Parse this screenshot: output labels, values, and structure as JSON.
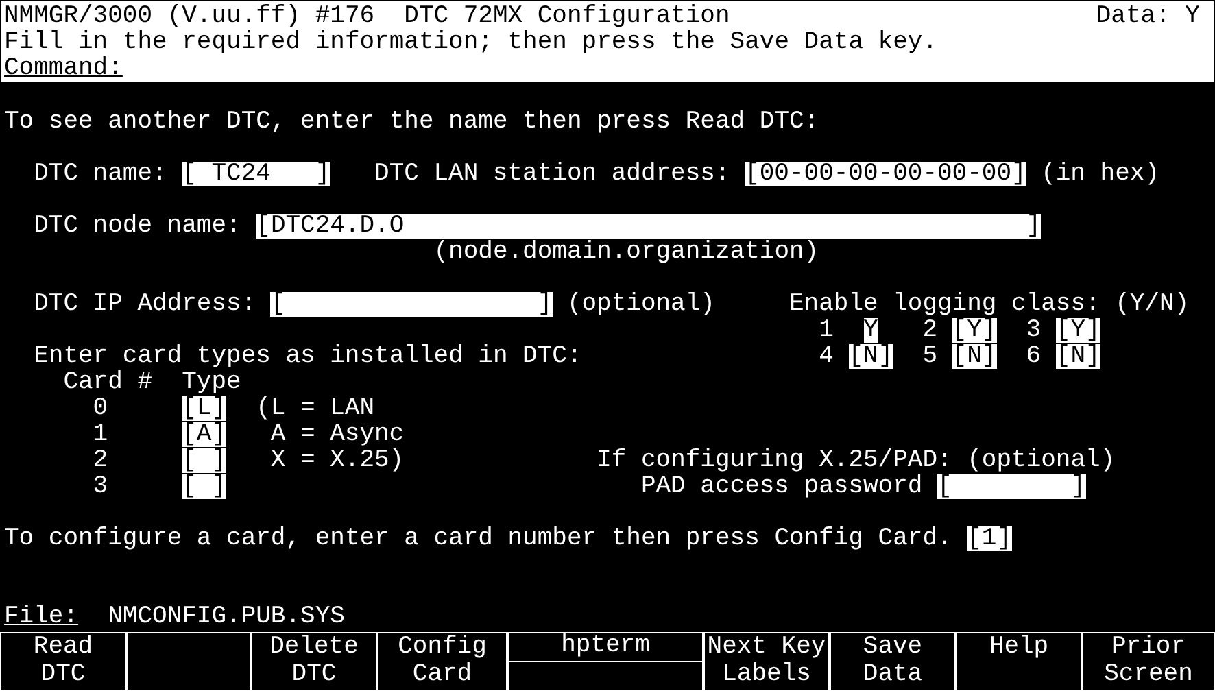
{
  "header": {
    "title": "NMMGR/3000 (V.uu.ff) #176  DTC 72MX Configuration",
    "data_flag": "Data: Y",
    "message": "Fill in the required information; then press the Save Data key.",
    "command_label": "Command:"
  },
  "instruction": "To see another DTC, enter the name then press Read DTC:",
  "dtc_name": {
    "label": "DTC name:",
    "field": {
      "left": "[",
      "value": " TC24",
      "right": "]"
    }
  },
  "lan_address": {
    "label": "DTC LAN station address:",
    "field": {
      "left": "[",
      "value": "00-00-00-00-00-00",
      "right": "]"
    },
    "note": "(in hex)"
  },
  "node_name": {
    "label": "DTC node name:",
    "field": {
      "left": "[",
      "value": "DTC24.D.O",
      "right": "]"
    },
    "hint": "(node.domain.organization)"
  },
  "ip_address": {
    "label": "DTC IP Address:",
    "field": {
      "left": "[",
      "right": "]"
    },
    "note": "(optional)"
  },
  "logging": {
    "label": "Enable logging class: (Y/N)",
    "classes": [
      {
        "number": "1",
        "field": {
          "value": "Y"
        }
      },
      {
        "number": "2",
        "field": {
          "left": "[",
          "value": "Y",
          "right": "]"
        }
      },
      {
        "number": "3",
        "field": {
          "left": "[",
          "value": "Y",
          "right": "]"
        }
      },
      {
        "number": "4",
        "field": {
          "left": "[",
          "value": "N",
          "right": "]"
        }
      },
      {
        "number": "5",
        "field": {
          "left": "[",
          "value": "N",
          "right": "]"
        }
      },
      {
        "number": "6",
        "field": {
          "left": "[",
          "value": "N",
          "right": "]"
        }
      }
    ]
  },
  "cards": {
    "label": "Enter card types as installed in DTC:",
    "column_card": "Card #",
    "column_type": "Type",
    "rows": [
      {
        "number": "0",
        "field": {
          "left": "[",
          "value": "L",
          "right": "]"
        },
        "legend": "(L = LAN"
      },
      {
        "number": "1",
        "field": {
          "left": "[",
          "value": "A",
          "right": "]"
        },
        "legend": " A = Async"
      },
      {
        "number": "2",
        "field": {
          "left": "[",
          "right": "]"
        },
        "legend": " X = X.25)"
      },
      {
        "number": "3",
        "field": {
          "left": "[",
          "right": "]"
        }
      }
    ]
  },
  "pad": {
    "label": "If configuring X.25/PAD: (optional)",
    "password_label": "PAD access password",
    "field": {
      "left": "[",
      "right": "]"
    }
  },
  "configure": {
    "label": "To configure a card, enter a card number then press Config Card.",
    "field": {
      "left": "[",
      "value": "1",
      "right": "]"
    }
  },
  "file": {
    "label": "File:",
    "value": "NMCONFIG.PUB.SYS"
  },
  "softkeys": [
    {
      "kind": "key",
      "line1": "Read",
      "line2": "DTC"
    },
    {
      "kind": "blank"
    },
    {
      "kind": "key",
      "line1": "Delete",
      "line2": "DTC"
    },
    {
      "kind": "key",
      "line1": "Config",
      "line2": "Card"
    },
    {
      "kind": "split",
      "line1": "hpterm"
    },
    {
      "kind": "key",
      "line1": "Next Key",
      "line2": "Labels"
    },
    {
      "kind": "key",
      "line1": "Save",
      "line2": "Data"
    },
    {
      "kind": "key",
      "line1": "Help"
    },
    {
      "kind": "key",
      "line1": "Prior",
      "line2": "Screen"
    }
  ]
}
